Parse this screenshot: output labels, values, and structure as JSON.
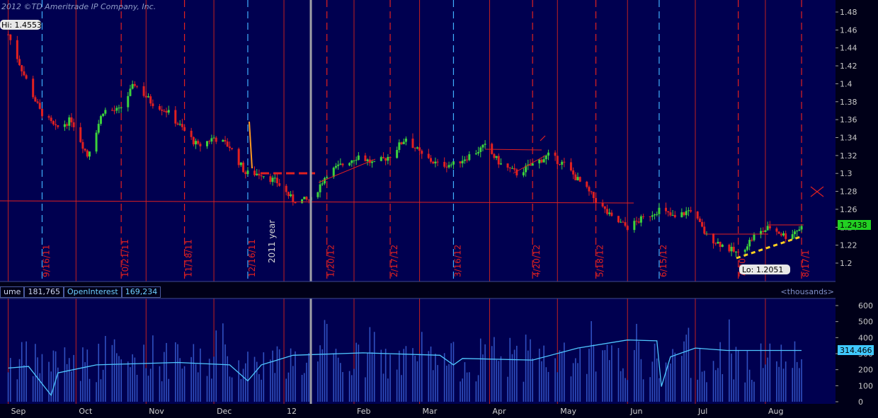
{
  "header": {
    "copyright": "2012 ©TD Ameritrade IP Company, Inc."
  },
  "price_panel": {
    "hi_label": "Hi: 1.4553",
    "lo_label": "Lo: 1.2051",
    "last_price": "1.2438",
    "year_label": "2011 year",
    "y_ticks": [
      "1.48",
      "1.46",
      "1.44",
      "1.42",
      "1.4",
      "1.38",
      "1.36",
      "1.34",
      "1.32",
      "1.3",
      "1.28",
      "1.26",
      "1.24",
      "1.22",
      "1.2"
    ],
    "cycle_dates": [
      "9/16/11",
      "10/21/11",
      "11/18/11",
      "12/16/11",
      "1/20/12",
      "2/17/12",
      "3/16/12",
      "4/20/12",
      "5/18/12",
      "6/15/12",
      "7/20",
      "8/17/1"
    ]
  },
  "volume_panel": {
    "volume_label": "ume",
    "volume_value": "181,765",
    "oi_label": "OpenInterest",
    "oi_value": "169,234",
    "units": "<thousands>",
    "oi_last": "314.466",
    "y_ticks": [
      "600",
      "500",
      "400",
      "300",
      "200",
      "100",
      "0"
    ]
  },
  "x_axis": {
    "months": [
      "Sep",
      "Oct",
      "Nov",
      "Dec",
      "12",
      "Feb",
      "Mar",
      "Apr",
      "May",
      "Jun",
      "Jul",
      "Aug"
    ]
  },
  "colors": {
    "background": "#000050",
    "up": "#3cd23c",
    "down": "#e02020",
    "grid": "#c02020",
    "cycle": "#40b0ff",
    "open_interest": "#50c8ff",
    "volume": "#3050c0"
  },
  "chart_data": {
    "type": "candlestick",
    "price_ylim": [
      1.19,
      1.49
    ],
    "volume_ylim": [
      0,
      600
    ],
    "price_path": [
      [
        "2011-09-01",
        1.455
      ],
      [
        "2011-09-08",
        1.41
      ],
      [
        "2011-09-15",
        1.37
      ],
      [
        "2011-09-22",
        1.35
      ],
      [
        "2011-09-29",
        1.36
      ],
      [
        "2011-10-06",
        1.32
      ],
      [
        "2011-10-13",
        1.37
      ],
      [
        "2011-10-20",
        1.37
      ],
      [
        "2011-10-27",
        1.4
      ],
      [
        "2011-11-03",
        1.38
      ],
      [
        "2011-11-10",
        1.37
      ],
      [
        "2011-11-17",
        1.35
      ],
      [
        "2011-11-24",
        1.33
      ],
      [
        "2011-12-01",
        1.34
      ],
      [
        "2011-12-08",
        1.33
      ],
      [
        "2011-12-15",
        1.3
      ],
      [
        "2011-12-22",
        1.3
      ],
      [
        "2011-12-29",
        1.29
      ],
      [
        "2012-01-05",
        1.27
      ],
      [
        "2012-01-13",
        1.27
      ],
      [
        "2012-01-20",
        1.3
      ],
      [
        "2012-01-27",
        1.31
      ],
      [
        "2012-02-03",
        1.32
      ],
      [
        "2012-02-10",
        1.31
      ],
      [
        "2012-02-17",
        1.32
      ],
      [
        "2012-02-24",
        1.34
      ],
      [
        "2012-03-02",
        1.32
      ],
      [
        "2012-03-09",
        1.31
      ],
      [
        "2012-03-16",
        1.31
      ],
      [
        "2012-03-23",
        1.32
      ],
      [
        "2012-03-30",
        1.33
      ],
      [
        "2012-04-06",
        1.31
      ],
      [
        "2012-04-13",
        1.3
      ],
      [
        "2012-04-20",
        1.31
      ],
      [
        "2012-04-27",
        1.32
      ],
      [
        "2012-05-04",
        1.31
      ],
      [
        "2012-05-11",
        1.29
      ],
      [
        "2012-05-18",
        1.27
      ],
      [
        "2012-05-25",
        1.25
      ],
      [
        "2012-06-01",
        1.24
      ],
      [
        "2012-06-08",
        1.25
      ],
      [
        "2012-06-15",
        1.26
      ],
      [
        "2012-06-22",
        1.25
      ],
      [
        "2012-06-29",
        1.26
      ],
      [
        "2012-07-06",
        1.23
      ],
      [
        "2012-07-13",
        1.22
      ],
      [
        "2012-07-20",
        1.21
      ],
      [
        "2012-07-27",
        1.23
      ],
      [
        "2012-08-03",
        1.24
      ],
      [
        "2012-08-10",
        1.23
      ],
      [
        "2012-08-17",
        1.24
      ]
    ],
    "open_interest_path": [
      [
        "2011-09-01",
        210
      ],
      [
        "2011-09-10",
        220
      ],
      [
        "2011-09-20",
        40
      ],
      [
        "2011-09-23",
        180
      ],
      [
        "2011-10-10",
        230
      ],
      [
        "2011-11-15",
        245
      ],
      [
        "2011-12-08",
        230
      ],
      [
        "2011-12-16",
        130
      ],
      [
        "2011-12-22",
        230
      ],
      [
        "2012-01-05",
        290
      ],
      [
        "2012-02-05",
        305
      ],
      [
        "2012-03-10",
        290
      ],
      [
        "2012-03-16",
        230
      ],
      [
        "2012-03-20",
        270
      ],
      [
        "2012-04-20",
        260
      ],
      [
        "2012-05-10",
        335
      ],
      [
        "2012-06-01",
        385
      ],
      [
        "2012-06-14",
        380
      ],
      [
        "2012-06-16",
        95
      ],
      [
        "2012-06-20",
        280
      ],
      [
        "2012-07-01",
        335
      ],
      [
        "2012-07-15",
        320
      ],
      [
        "2012-08-01",
        320
      ],
      [
        "2012-08-17",
        320
      ]
    ]
  }
}
